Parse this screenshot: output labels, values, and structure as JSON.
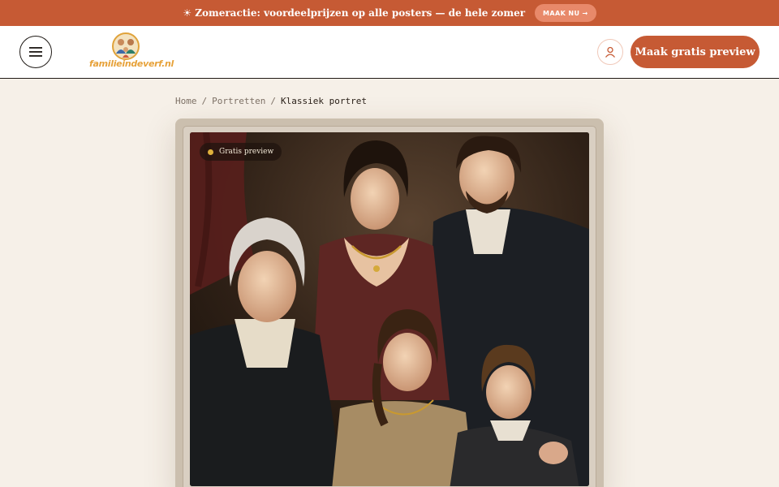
{
  "promo": {
    "text": "☀ Zomeractie: voordeelprijzen op alle posters — de hele zomer",
    "button_label": "MAAK NU →"
  },
  "header": {
    "logo_text": "familieindeverf.nl",
    "cta_label": "Maak gratis preview",
    "menu_icon": "hamburger-icon",
    "account_icon": "user-icon"
  },
  "breadcrumb": {
    "items": [
      "Home",
      "Portretten",
      "Klassiek portret"
    ],
    "separator": "/"
  },
  "product": {
    "badge_label": "Gratis preview"
  },
  "colors": {
    "accent": "#c65a34",
    "background": "#f6f0e8",
    "badge_dot": "#e0b13c"
  }
}
